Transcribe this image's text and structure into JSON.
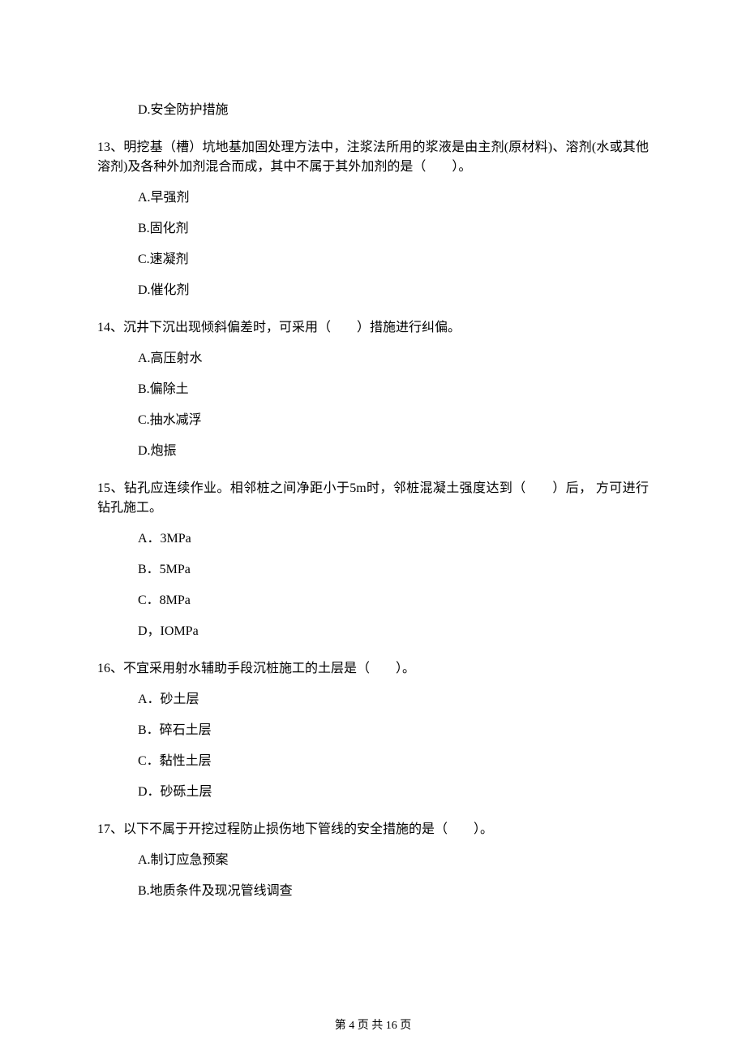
{
  "q12": {
    "optionD": "D.安全防护措施"
  },
  "q13": {
    "stem": "13、明挖基（槽）坑地基加固处理方法中，注浆法所用的浆液是由主剂(原材料)、溶剂(水或其他溶剂)及各种外加剂混合而成，其中不属于其外加剂的是（　　）。",
    "A": "A.早强剂",
    "B": "B.固化剂",
    "C": "C.速凝剂",
    "D": "D.催化剂"
  },
  "q14": {
    "stem": "14、沉井下沉出现倾斜偏差时，可采用（　　）措施进行纠偏。",
    "A": "A.高压射水",
    "B": "B.偏除土",
    "C": "C.抽水减浮",
    "D": "D.炮振"
  },
  "q15": {
    "stem": "15、钻孔应连续作业。相邻桩之间净距小于5m时，邻桩混凝土强度达到（　　）后， 方可进行钻孔施工。",
    "A": "A．3MPa",
    "B": "B．5MPa",
    "C": "C．8MPa",
    "D": "D，IOMPa"
  },
  "q16": {
    "stem": "16、不宜采用射水辅助手段沉桩施工的土层是（　　）。",
    "A": "A．砂土层",
    "B": "B．碎石土层",
    "C": "C．黏性土层",
    "D": "D．砂砾土层"
  },
  "q17": {
    "stem": "17、以下不属于开挖过程防止损伤地下管线的安全措施的是（　　）。",
    "A": "A.制订应急预案",
    "B": "B.地质条件及现况管线调查"
  },
  "footer": "第 4 页 共 16 页"
}
